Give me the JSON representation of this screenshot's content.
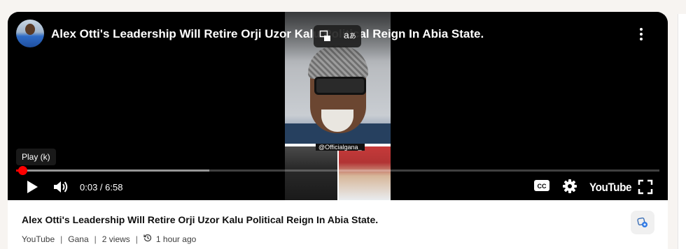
{
  "video": {
    "title": "Alex Otti's Leadership Will Retire Orji Uzor Kalu Political Reign In Abia State.",
    "watermark_handle": "@Officialgana_"
  },
  "player": {
    "tooltip": "Play (k)",
    "time_display": "0:03 / 6:58",
    "progress_fraction": 0.0072,
    "buffered_fraction": 0.3,
    "youtube_logo": "YouTube",
    "accent_color": "#ff0000"
  },
  "info": {
    "title": "Alex Otti's Leadership Will Retire Orji Uzor Kalu Political Reign In Abia State.",
    "source": "YouTube",
    "channel": "Gana",
    "views": "2 views",
    "time_ago": "1 hour ago",
    "separator": "|"
  },
  "icons": [
    "avatar",
    "more-vert-icon",
    "picture-in-picture-icon",
    "translate-icon",
    "play-icon",
    "volume-icon",
    "closed-captions-icon",
    "settings-gear-icon",
    "fullscreen-icon",
    "history-icon",
    "share-badge-icon"
  ]
}
